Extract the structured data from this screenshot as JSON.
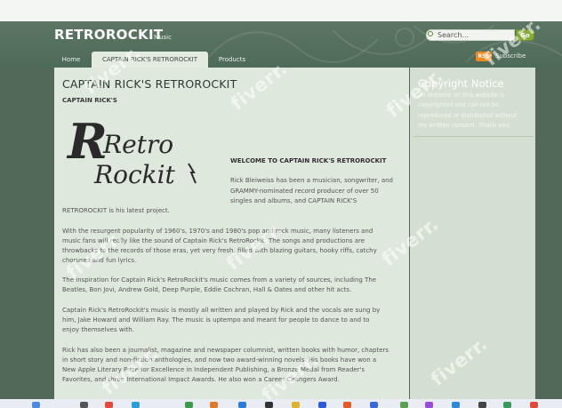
{
  "site": {
    "title": "RETROROCKIT",
    "tagline": "Music"
  },
  "search": {
    "placeholder": "Search...",
    "button_label": "Go"
  },
  "nav": {
    "items": [
      {
        "label": "Home",
        "active": false
      },
      {
        "label": "CAPTAIN RICK'S RETROROCKIT",
        "active": true
      },
      {
        "label": "Products",
        "active": false
      }
    ]
  },
  "subscribe": {
    "rss_label": "RSS",
    "label": "Subscribe"
  },
  "page": {
    "title": "CAPTAIN RICK'S RETROROCKIT",
    "subtitle": "CAPTAIN RICK'S",
    "logo_text": {
      "line1": "Retro",
      "line2": "Rockit"
    },
    "welcome": "WELCOME TO CAPTAIN RICK'S RETROROCKIT",
    "intro": [
      "Rick Bleiweiss has been a musician, songwriter, and",
      "GRAMMY-nominated record producer of over 50",
      "singles and albums, and CAPTAIN RICK'S",
      "RETROROCKIT is his latest project."
    ],
    "paragraphs": [
      [
        "With the resurgent popularity of 1960's, 1970's and 1980's pop and rock music, many listeners and",
        "music fans will really like the sound of Captain Rick's RetroRockit. The songs and productions are",
        "throwbacks to the records of those eras, yet very fresh, filled with blazing guitars, hooky riffs, catchy",
        "choruses and fun lyrics."
      ],
      [
        "The inspiration for Captain Rick's RetroRockit's music comes from a variety of sources, including The",
        "Beatles, Bon Jovi, Andrew Gold, Deep Purple, Eddie Cochran, Hall & Oates and other hit acts."
      ],
      [
        "Captain Rick's RetroRockit's music is mostly all written and played by Rick and the vocals are sung by",
        "him, Jake Howard and William Ray. The music is uptempo and meant for people to dance to and to",
        "enjoy themselves with."
      ],
      [
        "Rick has also been a journalist, magazine and newspaper columnist, written books with humor, chapters",
        "in short story and non-fiction anthologies, and now two award-winning novels. His books have won a",
        "New Apple Literary Prize for Excellence in Independent Publishing, a Bronze Medal from Reader's",
        "Favorites, and three International Impact Awards. He also won a Career Changers Award."
      ]
    ]
  },
  "sidebar": {
    "copyright_title": "Copyright Notice",
    "copyright_lines": [
      "All material on this website is",
      "copyrighted and can not be",
      "reproduced or distributed without",
      "my written consent. Thank you."
    ]
  },
  "watermark": "fiverr."
}
